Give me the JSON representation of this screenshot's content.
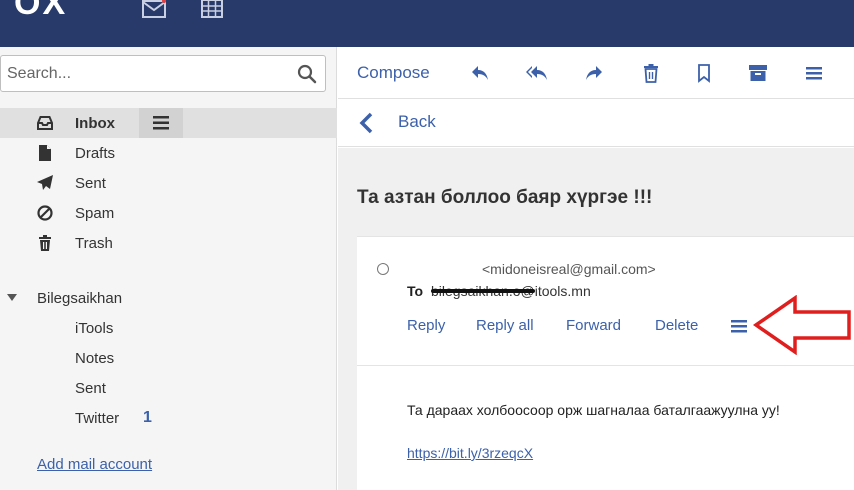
{
  "app": {
    "logo_text": "OX"
  },
  "search": {
    "placeholder": "Search..."
  },
  "folders": [
    {
      "label": "Inbox",
      "icon": "inbox-icon",
      "selected": true
    },
    {
      "label": "Drafts",
      "icon": "drafts-icon"
    },
    {
      "label": "Sent",
      "icon": "sent-icon"
    },
    {
      "label": "Spam",
      "icon": "spam-icon"
    },
    {
      "label": "Trash",
      "icon": "trash-icon"
    }
  ],
  "account": {
    "name": "Bilegsaikhan",
    "subfolders": [
      {
        "label": "iTools",
        "count": ""
      },
      {
        "label": "Notes",
        "count": ""
      },
      {
        "label": "Sent",
        "count": ""
      },
      {
        "label": "Twitter",
        "count": "1"
      }
    ]
  },
  "add_account_label": "Add mail account",
  "toolbar": {
    "compose_label": "Compose",
    "icons": [
      "reply-icon",
      "reply-all-icon",
      "forward-icon",
      "delete-icon",
      "bookmark-icon",
      "archive-icon",
      "more-menu-icon"
    ]
  },
  "back_label": "Back",
  "mail": {
    "subject": "Та азтан боллоо баяр хүргэе !!!",
    "from": "<midoneisreal@gmail.com>",
    "to_label": "To",
    "to": "bilegsaikhan.o@itools.mn",
    "actions": [
      "Reply",
      "Reply all",
      "Forward",
      "Delete"
    ],
    "body": "Та дараах холбоосоор орж шагналаа баталгаажуулна уу!",
    "link": "https://bit.ly/3rzeqcX"
  },
  "colors": {
    "topbar": "#283a69",
    "accent": "#3c61aa",
    "arrow": "#e01e1e"
  }
}
